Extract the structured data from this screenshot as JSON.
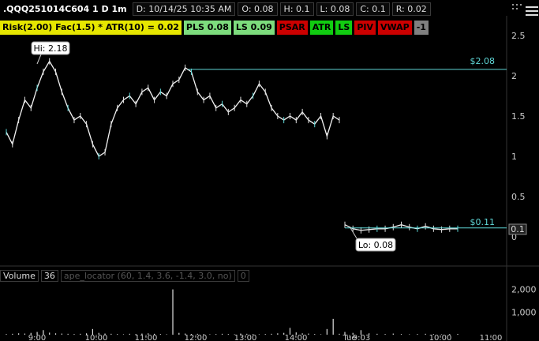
{
  "header": {
    "symbol": ".QQQ251014C604 1 D 1m",
    "date": "D: 10/14/25 10:35 AM",
    "open": "O: 0.08",
    "high": "H: 0.1",
    "low": "L: 0.08",
    "close": "C: 0.1",
    "range": "R: 0.02"
  },
  "studies": [
    {
      "label": "Risk(2.00) Fac(1.5) * ATR(10) = 0.02",
      "bg": "#e6e600",
      "fg": "#000000"
    },
    {
      "label": "PLS 0.08",
      "bg": "#7ddc7d",
      "fg": "#000000"
    },
    {
      "label": "LS 0.09",
      "bg": "#7ddc7d",
      "fg": "#000000"
    },
    {
      "label": "PSAR",
      "bg": "#cc0000",
      "fg": "#000000"
    },
    {
      "label": "ATR",
      "bg": "#11cc11",
      "fg": "#000000"
    },
    {
      "label": "LS",
      "bg": "#11cc11",
      "fg": "#000000"
    },
    {
      "label": "PIV",
      "bg": "#cc0000",
      "fg": "#000000"
    },
    {
      "label": "VWAP",
      "bg": "#cc0000",
      "fg": "#000000"
    },
    {
      "label": "-1",
      "bg": "#808080",
      "fg": "#000000"
    }
  ],
  "price_axis": {
    "ticks": [
      "2.5",
      "2",
      "1.5",
      "1",
      "0.5",
      "0"
    ]
  },
  "annotations": {
    "hi_label": "Hi: 2.18",
    "lo_label": "Lo: 0.08",
    "level_upper": "$2.08",
    "level_lower": "$0.11",
    "last_price": "0.1"
  },
  "volume_panel": {
    "title": "Volume",
    "value": "36",
    "study": "ape_locator (60, 1.4, 3.6, -1.4, 3.0, no)",
    "study_value": "0",
    "ticks": [
      "2,000",
      "1,000"
    ]
  },
  "time_axis": {
    "ticks": [
      "9:00",
      "10:00",
      "11:00",
      "12:00",
      "13:00",
      "14:00",
      "Tue",
      "9:03",
      "10:00",
      "11:00"
    ]
  },
  "chart_data": {
    "type": "line",
    "title": "",
    "xlabel": "",
    "ylabel": "",
    "ylim": [
      0,
      2.5
    ],
    "series": [
      {
        "name": "",
        "values": [
          1.3,
          1.15,
          1.45,
          1.7,
          1.6,
          1.85,
          2.05,
          2.18,
          2.05,
          1.8,
          1.6,
          1.45,
          1.5,
          1.4,
          1.15,
          1.0,
          1.05,
          1.4,
          1.6,
          1.7,
          1.75,
          1.65,
          1.8,
          1.85,
          1.7,
          1.8,
          1.75,
          1.9,
          1.95,
          2.1,
          2.05,
          1.8,
          1.7,
          1.75,
          1.6,
          1.65,
          1.55,
          1.6,
          1.7,
          1.65,
          1.75,
          1.9,
          1.8,
          1.6,
          1.5,
          1.45,
          1.5,
          1.45,
          1.55,
          1.45,
          1.4,
          1.5,
          1.25,
          1.5,
          1.45,
          null,
          0.15,
          0.1,
          0.08,
          0.09,
          0.1,
          0.1,
          0.12,
          0.15,
          0.12,
          0.1,
          0.13,
          0.1,
          0.09,
          0.1,
          0.1
        ]
      }
    ],
    "volume": [
      30,
      40,
      60,
      50,
      80,
      120,
      200,
      90,
      60,
      50,
      40,
      30,
      40,
      60,
      250,
      80,
      50,
      40,
      30,
      20,
      40,
      30,
      50,
      60,
      40,
      30,
      20,
      2000,
      80,
      50,
      30,
      40,
      30,
      20,
      30,
      40,
      30,
      20,
      50,
      40,
      30,
      20,
      30,
      40,
      60,
      80,
      300,
      100,
      60,
      50,
      30,
      20,
      250,
      700,
      40,
      0,
      120,
      80,
      200,
      60,
      40,
      30,
      50,
      30,
      20,
      30,
      40,
      30,
      20,
      30,
      36
    ],
    "volume_ylim": [
      0,
      2300
    ],
    "reference_lines": [
      2.08,
      0.11
    ]
  }
}
